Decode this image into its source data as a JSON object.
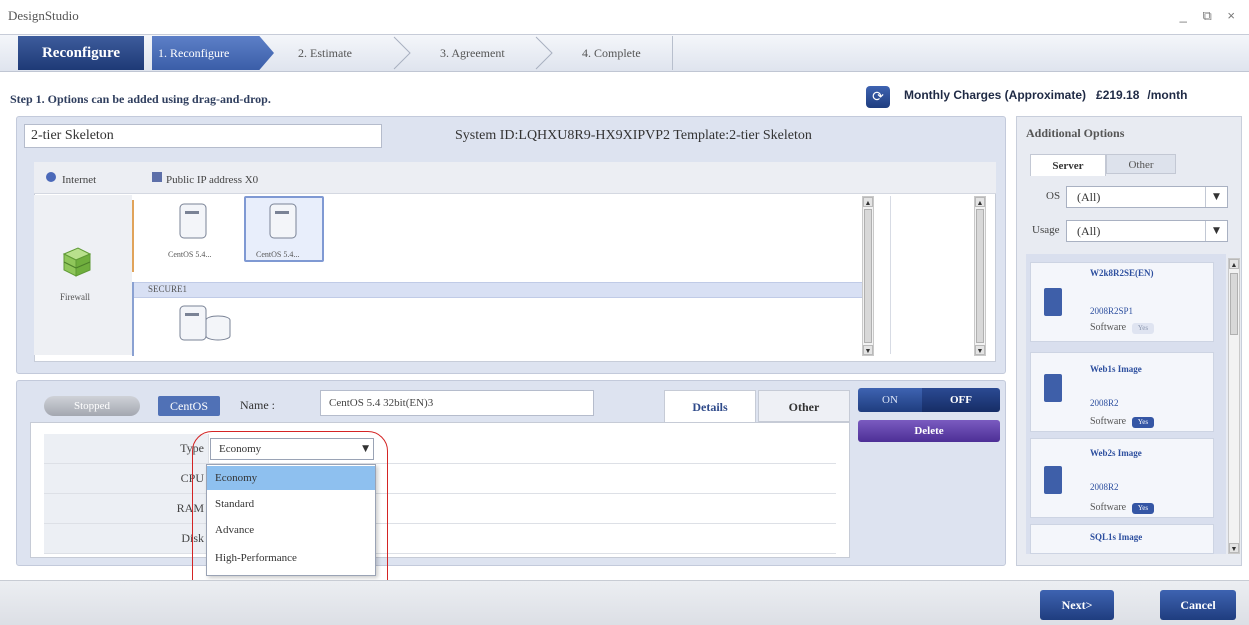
{
  "window": {
    "title": "DesignStudio",
    "controls": "_ ⧉ ×"
  },
  "wizard": {
    "head": "Reconfigure",
    "steps": [
      {
        "label": "1. Reconfigure",
        "active": true
      },
      {
        "label": "2. Estimate",
        "active": false
      },
      {
        "label": "3. Agreement",
        "active": false
      },
      {
        "label": "4. Complete",
        "active": false
      }
    ]
  },
  "step_message": "Step 1. Options can be added using drag-and-drop.",
  "charges": {
    "label": "Monthly Charges (Approximate)",
    "amount": "£219.18",
    "period": "/month"
  },
  "system": {
    "name": "2-tier Skeleton",
    "info": "System ID:LQHXU8R9-HX9XIPVP2  Template:2-tier Skeleton"
  },
  "network": {
    "internet_label": "Internet",
    "public_ip_label": "Public IP address X0",
    "firewall_label": "Firewall",
    "segment_label": "SECURE1",
    "servers": [
      {
        "label": "CentOS 5.4..."
      },
      {
        "label": "CentOS 5.4..."
      }
    ]
  },
  "additional_options": {
    "title": "Additional Options",
    "tabs": {
      "server": "Server",
      "other": "Other"
    },
    "filters": {
      "os_label": "OS",
      "os_value": "(All)",
      "usage_label": "Usage",
      "usage_value": "(All)"
    },
    "items": [
      {
        "name": "W2k8R2SE(EN)",
        "version": "2008R2SP1",
        "type": "Software",
        "badge": "Yes"
      },
      {
        "name": "Web1s Image",
        "version": "2008R2",
        "type": "Software",
        "badge": "Yes"
      },
      {
        "name": "Web2s Image",
        "version": "2008R2",
        "type": "Software",
        "badge": "Yes"
      },
      {
        "name": "SQL1s Image",
        "version": "",
        "type": "",
        "badge": ""
      }
    ]
  },
  "detail": {
    "status": "Stopped",
    "os_badge": "CentOS",
    "name_label": "Name :",
    "name_value": "CentOS 5.4 32bit(EN)3",
    "tabs": {
      "details": "Details",
      "other": "Other"
    },
    "toggle": {
      "on": "ON",
      "off": "OFF"
    },
    "delete_label": "Delete",
    "specs": {
      "type": "Type",
      "cpu": "CPU",
      "ram": "RAM",
      "disk": "Disk"
    },
    "type_value": "Economy",
    "type_options": [
      "Economy",
      "Standard",
      "Advance",
      "High-Performance"
    ],
    "selected_option": "Economy"
  },
  "footer": {
    "next": "Next>",
    "cancel": "Cancel"
  },
  "colors": {
    "brand": "#1e3a76",
    "accent": "#3b5ea8",
    "highlight": "#8ec0ef",
    "ring": "#d42424"
  }
}
